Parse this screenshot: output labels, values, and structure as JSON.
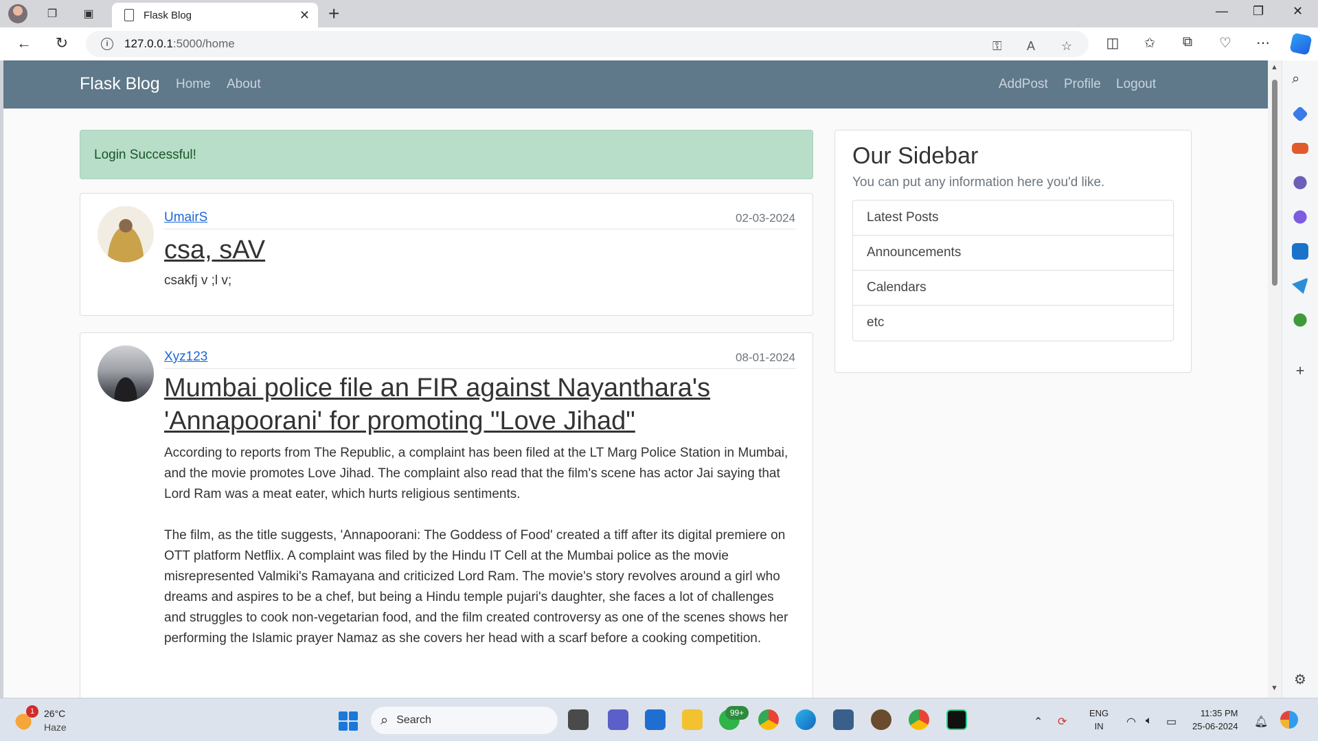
{
  "browser": {
    "tab_title": "Flask Blog",
    "url_host": "127.0.0.1",
    "url_path": ":5000/home"
  },
  "navbar": {
    "brand": "Flask Blog",
    "left_links": [
      "Home",
      "About"
    ],
    "right_links": [
      "AddPost",
      "Profile",
      "Logout"
    ]
  },
  "alert": {
    "message": "Login Successful!"
  },
  "posts": [
    {
      "author": "UmairS",
      "date": "02-03-2024",
      "title": "csa, sAV",
      "body": "csakfj v ;l v;"
    },
    {
      "author": "Xyz123",
      "date": "08-01-2024",
      "title": "Mumbai police file an FIR against Nayanthara's 'Annapoorani' for promoting \"Love Jihad\"",
      "body": "According to reports from The Republic, a complaint has been filed at the LT Marg Police Station in Mumbai, and the movie promotes Love Jihad. The complaint also read that the film's scene has actor Jai saying that Lord Ram was a meat eater, which hurts religious sentiments.\n\nThe film, as the title suggests, 'Annapoorani: The Goddess of Food' created a tiff after its digital premiere on OTT platform Netflix. A complaint was filed by the Hindu IT Cell at the Mumbai police as the movie misrepresented Valmiki's Ramayana and criticized Lord Ram. The movie's story revolves around a girl who dreams and aspires to be a chef, but being a Hindu temple pujari's daughter, she faces a lot of challenges and struggles to cook non-vegetarian food, and the film created controversy as one of the scenes shows her performing the Islamic prayer Namaz as she covers her head with a scarf before a cooking competition."
    }
  ],
  "sidebar": {
    "title": "Our Sidebar",
    "subtitle": "You can put any information here you'd like.",
    "items": [
      "Latest Posts",
      "Announcements",
      "Calendars",
      "etc"
    ]
  },
  "taskbar": {
    "weather_temp": "26°C",
    "weather_cond": "Haze",
    "weather_badge": "1",
    "search_label": "Search",
    "whatsapp_badge": "99+",
    "lang_line1": "ENG",
    "lang_line2": "IN",
    "time": "11:35 PM",
    "date": "25-06-2024"
  },
  "colors": {
    "navbar_bg": "#5f788a",
    "alert_bg": "#b8ddc9",
    "link": "#1a66d6"
  }
}
